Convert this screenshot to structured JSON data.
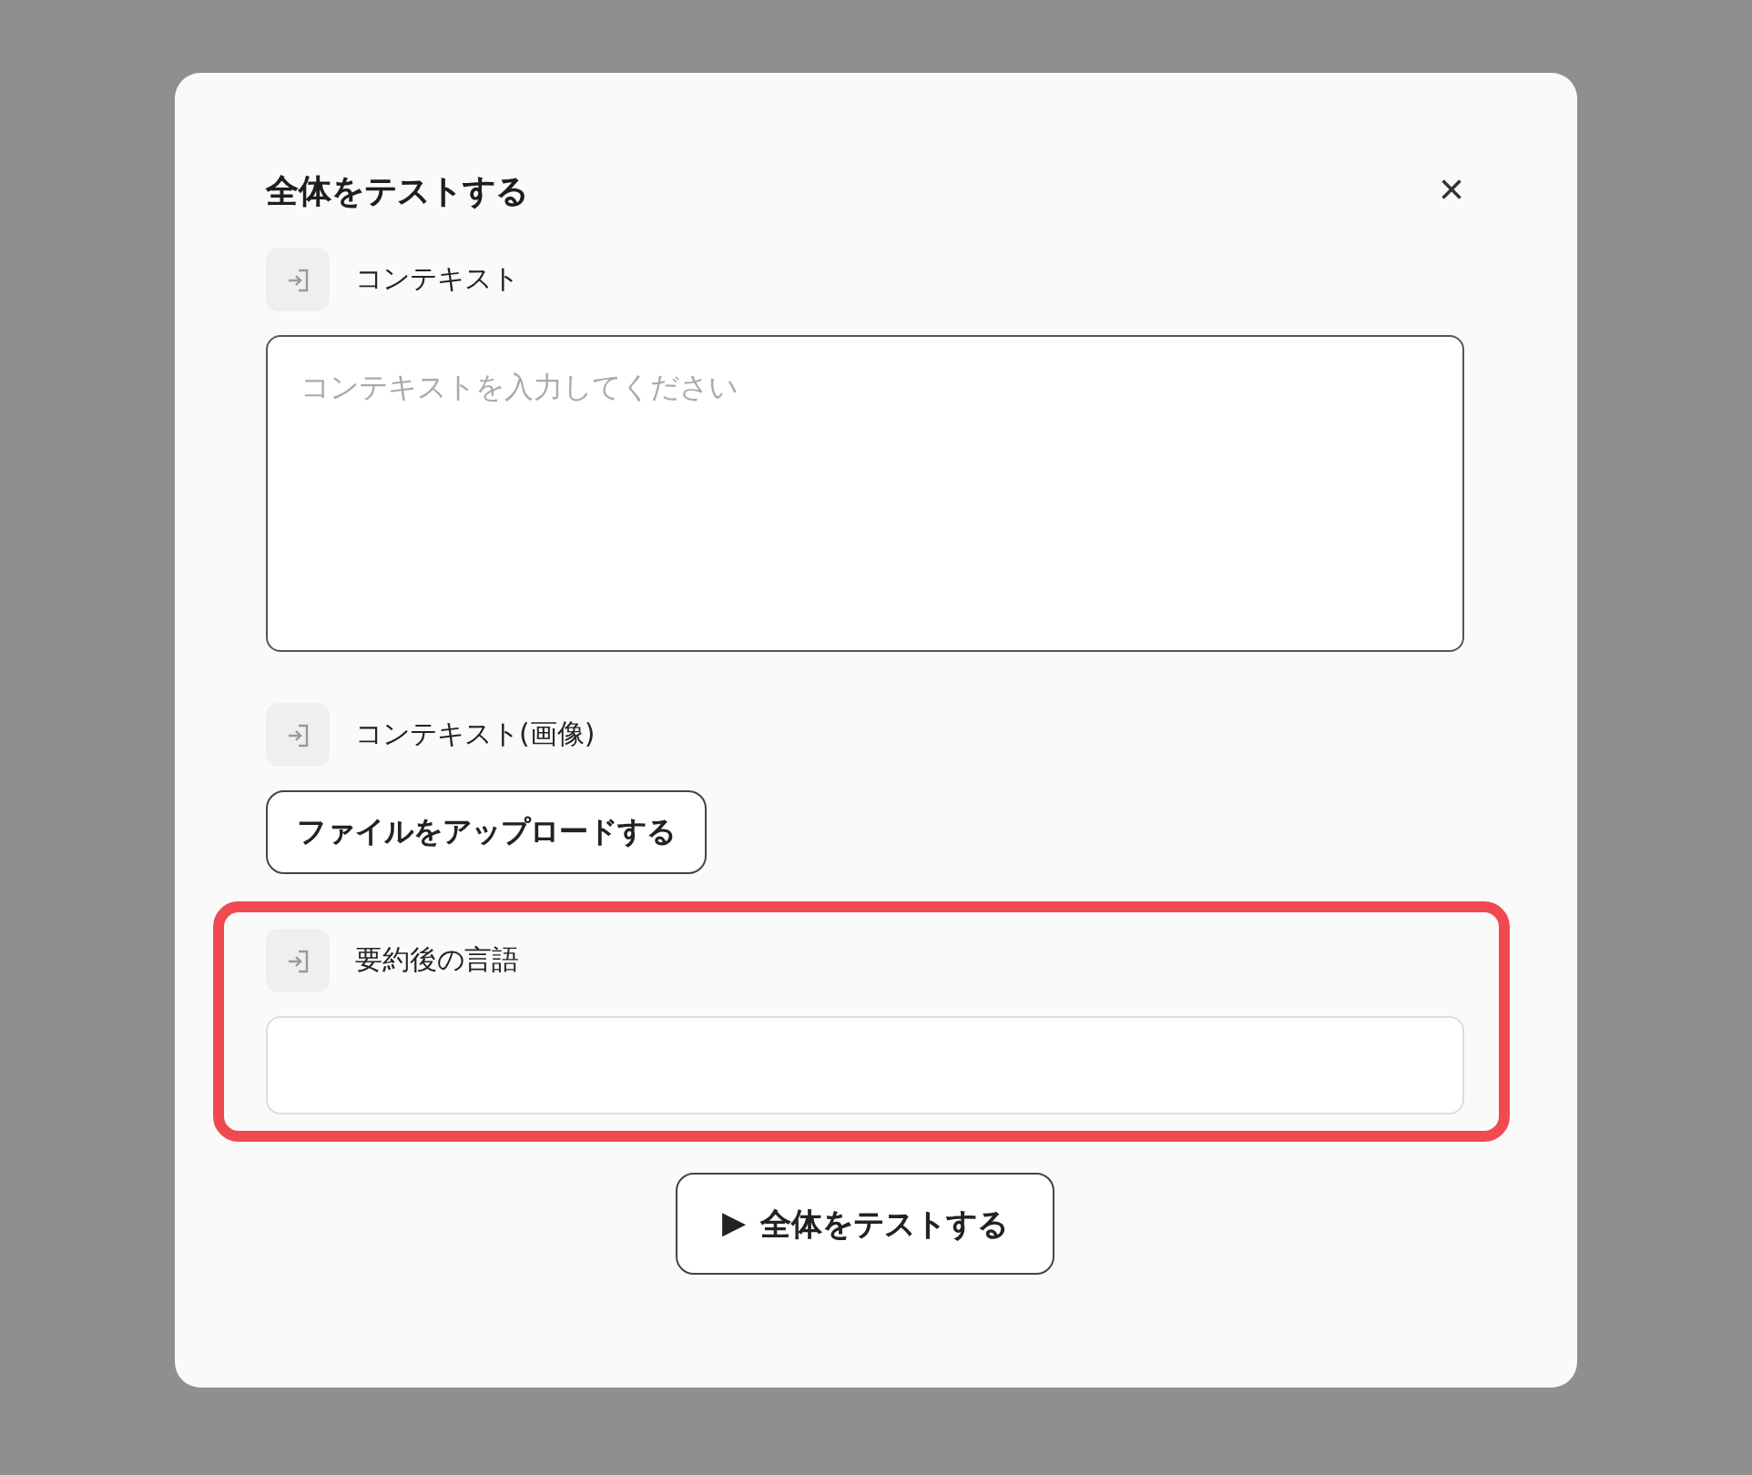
{
  "dialog": {
    "title": "全体をテストする",
    "close": "×",
    "inputs": [
      {
        "kind": "textarea",
        "label": "コンテキスト",
        "placeholder": "コンテキストを入力してください",
        "highlighted": false
      },
      {
        "kind": "upload",
        "label": "コンテキスト(画像)",
        "button": "ファイルをアップロードする",
        "highlighted": false
      },
      {
        "kind": "text",
        "label": "要約後の言語",
        "highlighted": true
      }
    ],
    "run_button": {
      "icon": "▶",
      "label": "全体をテストする"
    }
  }
}
